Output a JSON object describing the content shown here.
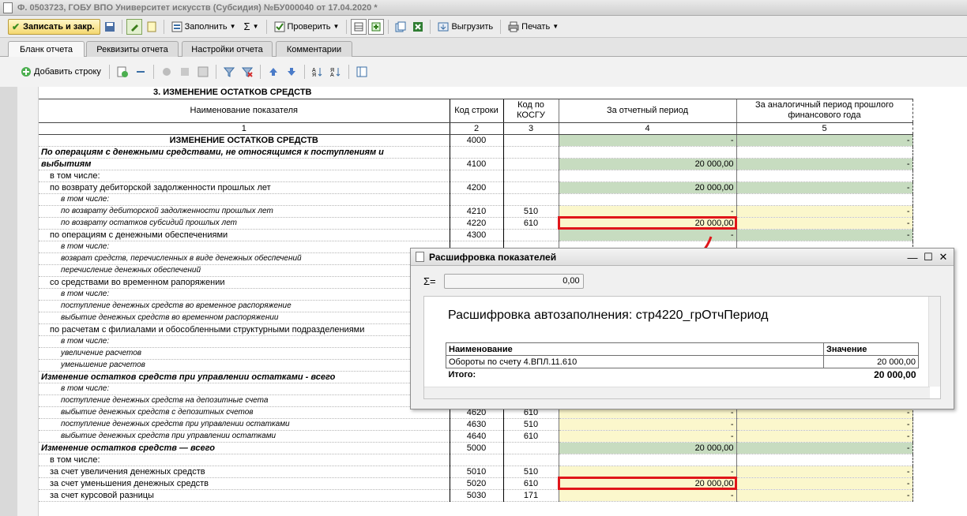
{
  "window": {
    "title": "Ф. 0503723, ГОБУ ВПО Университет искусств (Субсидия) №БУ000040 от 17.04.2020 *"
  },
  "toolbar": {
    "save_close": "Записать и закр.",
    "fill": "Заполнить",
    "check": "Проверить",
    "export": "Выгрузить",
    "print": "Печать"
  },
  "tabs": [
    "Бланк отчета",
    "Реквизиты отчета",
    "Настройки отчета",
    "Комментарии"
  ],
  "toolbar2": {
    "add_row": "Добавить строку"
  },
  "report": {
    "section_title": "3. ИЗМЕНЕНИЕ ОСТАТКОВ СРЕДСТВ",
    "headers": {
      "name": "Наименование показателя",
      "code": "Код строки",
      "kosgu": "Код по КОСГУ",
      "period": "За отчетный период",
      "prev": "За аналогичный период прошлого финансового года"
    },
    "col_numbers": [
      "1",
      "2",
      "3",
      "4",
      "5"
    ],
    "rows": [
      {
        "name": "ИЗМЕНЕНИЕ ОСТАТКОВ СРЕДСТВ",
        "code": "4000",
        "kosgu": "",
        "v4": "-",
        "v5": "-"
      },
      {
        "name": "По операциям с денежными средствами, не относящимся к поступлениям и",
        "code": "",
        "kosgu": "",
        "v4": "",
        "v5": ""
      },
      {
        "name": "выбытиям",
        "code": "4100",
        "kosgu": "",
        "v4": "20 000,00",
        "v5": "-"
      },
      {
        "name": "в том числе:",
        "code": "",
        "kosgu": "",
        "v4": "",
        "v5": ""
      },
      {
        "name": "по возврату дебиторской задолженности прошлых лет",
        "code": "4200",
        "kosgu": "",
        "v4": "20 000,00",
        "v5": "-"
      },
      {
        "name": "в том числе:",
        "code": "",
        "kosgu": "",
        "v4": "",
        "v5": ""
      },
      {
        "name": "по возврату дебиторской задолженности прошлых лет",
        "code": "4210",
        "kosgu": "510",
        "v4": "-",
        "v5": "-"
      },
      {
        "name": "по возврату остатков субсидий прошлых лет",
        "code": "4220",
        "kosgu": "610",
        "v4": "20 000,00",
        "v5": "-"
      },
      {
        "name": "по операциям с денежными обеспечениями",
        "code": "4300",
        "kosgu": "",
        "v4": "-",
        "v5": "-"
      },
      {
        "name": "в том числе:",
        "code": "",
        "kosgu": "",
        "v4": "",
        "v5": ""
      },
      {
        "name": "возврат средств, перечисленных в виде денежных обеспечений",
        "code": "",
        "kosgu": "",
        "v4": "",
        "v5": ""
      },
      {
        "name": "перечисление денежных обеспечений",
        "code": "",
        "kosgu": "",
        "v4": "",
        "v5": ""
      },
      {
        "name": "со средствами во временном рапоряжении",
        "code": "",
        "kosgu": "",
        "v4": "",
        "v5": ""
      },
      {
        "name": "в том числе:",
        "code": "",
        "kosgu": "",
        "v4": "",
        "v5": ""
      },
      {
        "name": "поступление денежных средств во временное распоряжение",
        "code": "",
        "kosgu": "",
        "v4": "",
        "v5": ""
      },
      {
        "name": "выбытие денежных средств во временном распоряжении",
        "code": "",
        "kosgu": "",
        "v4": "",
        "v5": ""
      },
      {
        "name": "по расчетам с филиалами и обособленными структурными подразделениями",
        "code": "",
        "kosgu": "",
        "v4": "",
        "v5": ""
      },
      {
        "name": "в том числе:",
        "code": "",
        "kosgu": "",
        "v4": "",
        "v5": ""
      },
      {
        "name": "увеличение расчетов",
        "code": "",
        "kosgu": "",
        "v4": "",
        "v5": ""
      },
      {
        "name": "уменьшение расчетов",
        "code": "",
        "kosgu": "",
        "v4": "",
        "v5": ""
      },
      {
        "name": "Изменение остатков средств при управлении остатками - всего",
        "code": "",
        "kosgu": "",
        "v4": "",
        "v5": ""
      },
      {
        "name": "в том числе:",
        "code": "",
        "kosgu": "",
        "v4": "",
        "v5": ""
      },
      {
        "name": "поступление денежных средств на  депозитные счета",
        "code": "",
        "kosgu": "",
        "v4": "",
        "v5": ""
      },
      {
        "name": "выбытие денежных средств с депозитных счетов",
        "code": "4620",
        "kosgu": "610",
        "v4": "-",
        "v5": "-"
      },
      {
        "name": "поступление денежных средств при управлении остатками",
        "code": "4630",
        "kosgu": "510",
        "v4": "-",
        "v5": "-"
      },
      {
        "name": "выбытие денежных средств при управлении остатками",
        "code": "4640",
        "kosgu": "610",
        "v4": "-",
        "v5": "-"
      },
      {
        "name": "Изменение остатков средств — всего",
        "code": "5000",
        "kosgu": "",
        "v4": "20 000,00",
        "v5": "-"
      },
      {
        "name": "в том числе:",
        "code": "",
        "kosgu": "",
        "v4": "",
        "v5": ""
      },
      {
        "name": "за счет увеличения денежных средств",
        "code": "5010",
        "kosgu": "510",
        "v4": "-",
        "v5": "-"
      },
      {
        "name": "за счет уменьшения денежных средств",
        "code": "5020",
        "kosgu": "610",
        "v4": "20 000,00",
        "v5": "-"
      },
      {
        "name": "за счет курсовой разницы",
        "code": "5030",
        "kosgu": "171",
        "v4": "-",
        "v5": "-"
      }
    ]
  },
  "dialog": {
    "title": "Расшифровка показателей",
    "sum_label": "Σ=",
    "sum_value": "0,00",
    "heading": "Расшифровка автозаполнения: стр4220_грОтчПериод",
    "col_name": "Наименование",
    "col_value": "Значение",
    "row_name": "Обороты по счету 4.ВПЛ.11.610",
    "row_value": "20 000,00",
    "total_label": "Итого:",
    "total_value": "20 000,00"
  },
  "colors": {
    "green_cell": "#c7dcc0",
    "yellow_cell": "#fbf7cc",
    "highlight": "#e0161a"
  }
}
